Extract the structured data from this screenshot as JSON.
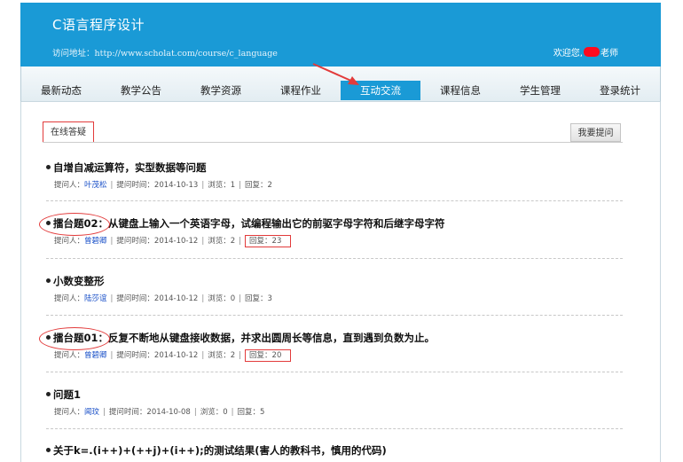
{
  "header": {
    "course_title": "C语言程序设计",
    "visit_label": "访问地址：",
    "visit_url": "http://www.scholat.com/course/c_language",
    "welcome_prefix": "欢迎您,",
    "welcome_suffix": "老师"
  },
  "nav": {
    "items": [
      "最新动态",
      "教学公告",
      "教学资源",
      "课程作业",
      "互动交流",
      "课程信息",
      "学生管理",
      "登录统计"
    ],
    "active_index": 4
  },
  "tabs": {
    "online_label": "在线答疑",
    "ask_button": "我要提问"
  },
  "labels": {
    "asker": "提问人：",
    "time": "提问时间：",
    "views": "浏览：",
    "replies": "回复：",
    "sep": "|"
  },
  "questions": [
    {
      "title": "自增自减运算符，实型数据等问题",
      "asker": "叶茂松",
      "time": "2014-10-13",
      "views": "1",
      "replies": "2"
    },
    {
      "title": "擂台题02：从键盘上输入一个英语字母，试编程输出它的前驱字母字符和后继字母字符",
      "asker": "曾碧卿",
      "time": "2014-10-12",
      "views": "2",
      "replies": "23"
    },
    {
      "title": "小数变整形",
      "asker": "陆莎谊",
      "time": "2014-10-12",
      "views": "0",
      "replies": "3"
    },
    {
      "title": "擂台题01：反复不断地从键盘接收数据，并求出圆周长等信息，直到遇到负数为止。",
      "asker": "曾碧卿",
      "time": "2014-10-12",
      "views": "2",
      "replies": "20"
    },
    {
      "title": "问题1",
      "asker": "闻玟",
      "time": "2014-10-08",
      "views": "0",
      "replies": "5"
    },
    {
      "title": "关于k=.(i++)+(++j)+(i++);的测试结果(害人的教科书，慎用的代码)"
    }
  ],
  "colors": {
    "brand_blue": "#1a9ad6",
    "annotation_red": "#e23b3b"
  }
}
